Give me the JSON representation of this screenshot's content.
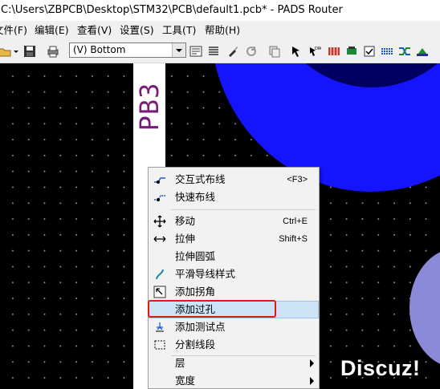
{
  "window": {
    "title": "C:\\Users\\ZBPCB\\Desktop\\STM32\\PCB\\default1.pcb* - PADS Router"
  },
  "menubar": {
    "items": [
      {
        "label": "文件(F)"
      },
      {
        "label": "编辑(E)"
      },
      {
        "label": "查看(V)"
      },
      {
        "label": "设置(S)"
      },
      {
        "label": "工具(T)"
      },
      {
        "label": "帮助(H)"
      }
    ]
  },
  "toolbar": {
    "layer_select_value": "(V) Bottom"
  },
  "canvas": {
    "net_label": "PB3"
  },
  "context_menu": {
    "items": [
      {
        "label": "交互式布线",
        "shortcut": "<F3>"
      },
      {
        "label": "快速布线",
        "shortcut": ""
      },
      {
        "label": "移动",
        "shortcut": "Ctrl+E"
      },
      {
        "label": "拉伸",
        "shortcut": "Shift+S"
      },
      {
        "label": "拉伸圆弧",
        "shortcut": ""
      },
      {
        "label": "平滑导线样式",
        "shortcut": ""
      },
      {
        "label": "添加拐角",
        "shortcut": ""
      },
      {
        "label": "添加过孔",
        "shortcut": ""
      },
      {
        "label": "添加测试点",
        "shortcut": ""
      },
      {
        "label": "分割线段",
        "shortcut": ""
      },
      {
        "label": "层",
        "shortcut": ""
      },
      {
        "label": "宽度",
        "shortcut": ""
      }
    ]
  },
  "watermark": {
    "text": "Discuz!"
  },
  "colors": {
    "canvas_bg": "#000000",
    "pad_blue": "#1414ff",
    "pad_dark_blue": "#000060",
    "pad_light_blue": "#8a8ad8",
    "net_label": "#7a1b7a",
    "highlight_border": "#e01818",
    "menu_highlight": "#cde3f7"
  }
}
